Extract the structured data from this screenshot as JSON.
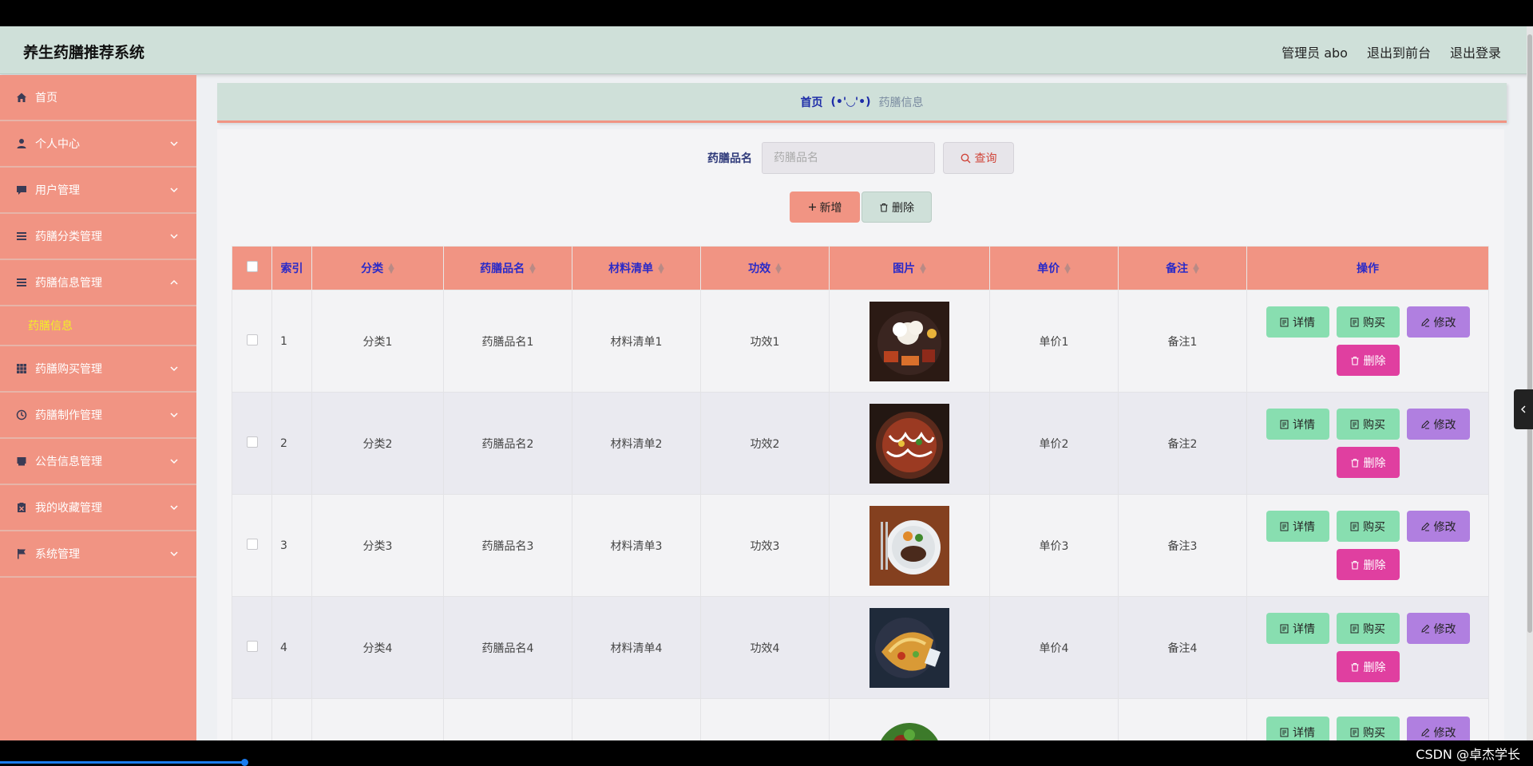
{
  "header": {
    "title": "养生药膳推荐系统",
    "admin_label": "管理员 abo",
    "back_to_front": "退出到前台",
    "logout": "退出登录"
  },
  "sidebar": {
    "items": [
      {
        "label": "首页",
        "icon": "home-icon"
      },
      {
        "label": "个人中心",
        "icon": "user-icon"
      },
      {
        "label": "用户管理",
        "icon": "chat-icon"
      },
      {
        "label": "药膳分类管理",
        "icon": "list-icon"
      },
      {
        "label": "药膳信息管理",
        "icon": "list-icon"
      },
      {
        "label": "药膳信息",
        "icon": ""
      },
      {
        "label": "药膳购买管理",
        "icon": "grid-icon"
      },
      {
        "label": "药膳制作管理",
        "icon": "clock-icon"
      },
      {
        "label": "公告信息管理",
        "icon": "inbox-icon"
      },
      {
        "label": "我的收藏管理",
        "icon": "clipboard-icon"
      },
      {
        "label": "系统管理",
        "icon": "flag-icon"
      }
    ]
  },
  "breadcrumb": {
    "home": "首页",
    "separator": "(•'◡'•)",
    "current": "药膳信息"
  },
  "search": {
    "label": "药膳品名",
    "placeholder": "药膳品名",
    "query_button": "查询"
  },
  "actions": {
    "add": "新增",
    "delete": "删除"
  },
  "table": {
    "headers": [
      "索引",
      "分类",
      "药膳品名",
      "材料清单",
      "功效",
      "图片",
      "单价",
      "备注",
      "操作"
    ],
    "rows": [
      {
        "index": "1",
        "category": "分类1",
        "name": "药膳品名1",
        "materials": "材料清单1",
        "effect": "功效1",
        "price": "单价1",
        "note": "备注1"
      },
      {
        "index": "2",
        "category": "分类2",
        "name": "药膳品名2",
        "materials": "材料清单2",
        "effect": "功效2",
        "price": "单价2",
        "note": "备注2"
      },
      {
        "index": "3",
        "category": "分类3",
        "name": "药膳品名3",
        "materials": "材料清单3",
        "effect": "功效3",
        "price": "单价3",
        "note": "备注3"
      },
      {
        "index": "4",
        "category": "分类4",
        "name": "药膳品名4",
        "materials": "材料清单4",
        "effect": "功效4",
        "price": "单价4",
        "note": "备注4"
      }
    ],
    "row_buttons": {
      "detail": "详情",
      "buy": "购买",
      "edit": "修改",
      "remove": "删除"
    }
  },
  "watermark": "CSDN @卓杰学长",
  "colors": {
    "accent": "#f19483",
    "header_bg": "#cfe0d9",
    "active_submenu": "#f3ee27",
    "detail_btn": "#88deb0",
    "edit_btn": "#b07fe0",
    "remove_btn": "#e03fa0"
  }
}
